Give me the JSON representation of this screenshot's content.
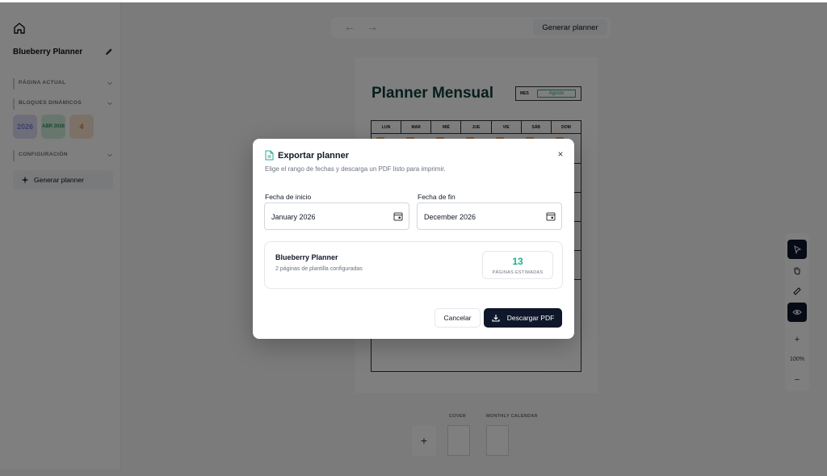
{
  "sidebar": {
    "project_name": "Blueberry Planner",
    "sections": {
      "current_page": "PÁGINA ACTUAL",
      "dynamic_blocks": "BLOQUES DINÁMICOS",
      "configuration": "CONFIGURACIÓN"
    },
    "blocks": [
      {
        "label": "2026",
        "color": "#7c7fd6",
        "bg": "#dcdcf6"
      },
      {
        "label": "ABR 2026",
        "color": "#2f8a5a",
        "bg": "#cfeedd"
      },
      {
        "label": "4",
        "color": "#d07a3a",
        "bg": "#f8e2cf"
      }
    ],
    "generate_label": "Generar planner"
  },
  "topbar": {
    "back": "←",
    "forward": "→",
    "generate_label": "Generar planner"
  },
  "planner": {
    "title": "Planner Mensual",
    "month_label": "MES",
    "month_value": "Agosto",
    "days": [
      "LUN",
      "MAR",
      "MIÉ",
      "JUE",
      "VIE",
      "SÁB",
      "DOM"
    ]
  },
  "thumbnails": {
    "plus": "+",
    "items": [
      "COVER",
      "MONTHLY CALENDAR"
    ]
  },
  "tools": {
    "zoom_in": "+",
    "zoom_level": "100%",
    "zoom_out": "−"
  },
  "modal": {
    "title": "Exportar planner",
    "subtitle": "Elige el rango de fechas y descarga un PDF listo para imprimir.",
    "close": "×",
    "start_label": "Fecha de inicio",
    "start_value": "January 2026",
    "end_label": "Fecha de fin",
    "end_value": "December 2026",
    "summary_name": "Blueberry Planner",
    "summary_desc": "2 páginas de plantilla configuradas",
    "estimated_count": "13",
    "estimated_label": "PÁGINAS ESTIMADAS",
    "cancel_label": "Cancelar",
    "download_label": "Descargar PDF"
  },
  "colors": {
    "accent": "#0f172a",
    "success": "#1fae8c",
    "planner_title": "#0f3d36"
  }
}
